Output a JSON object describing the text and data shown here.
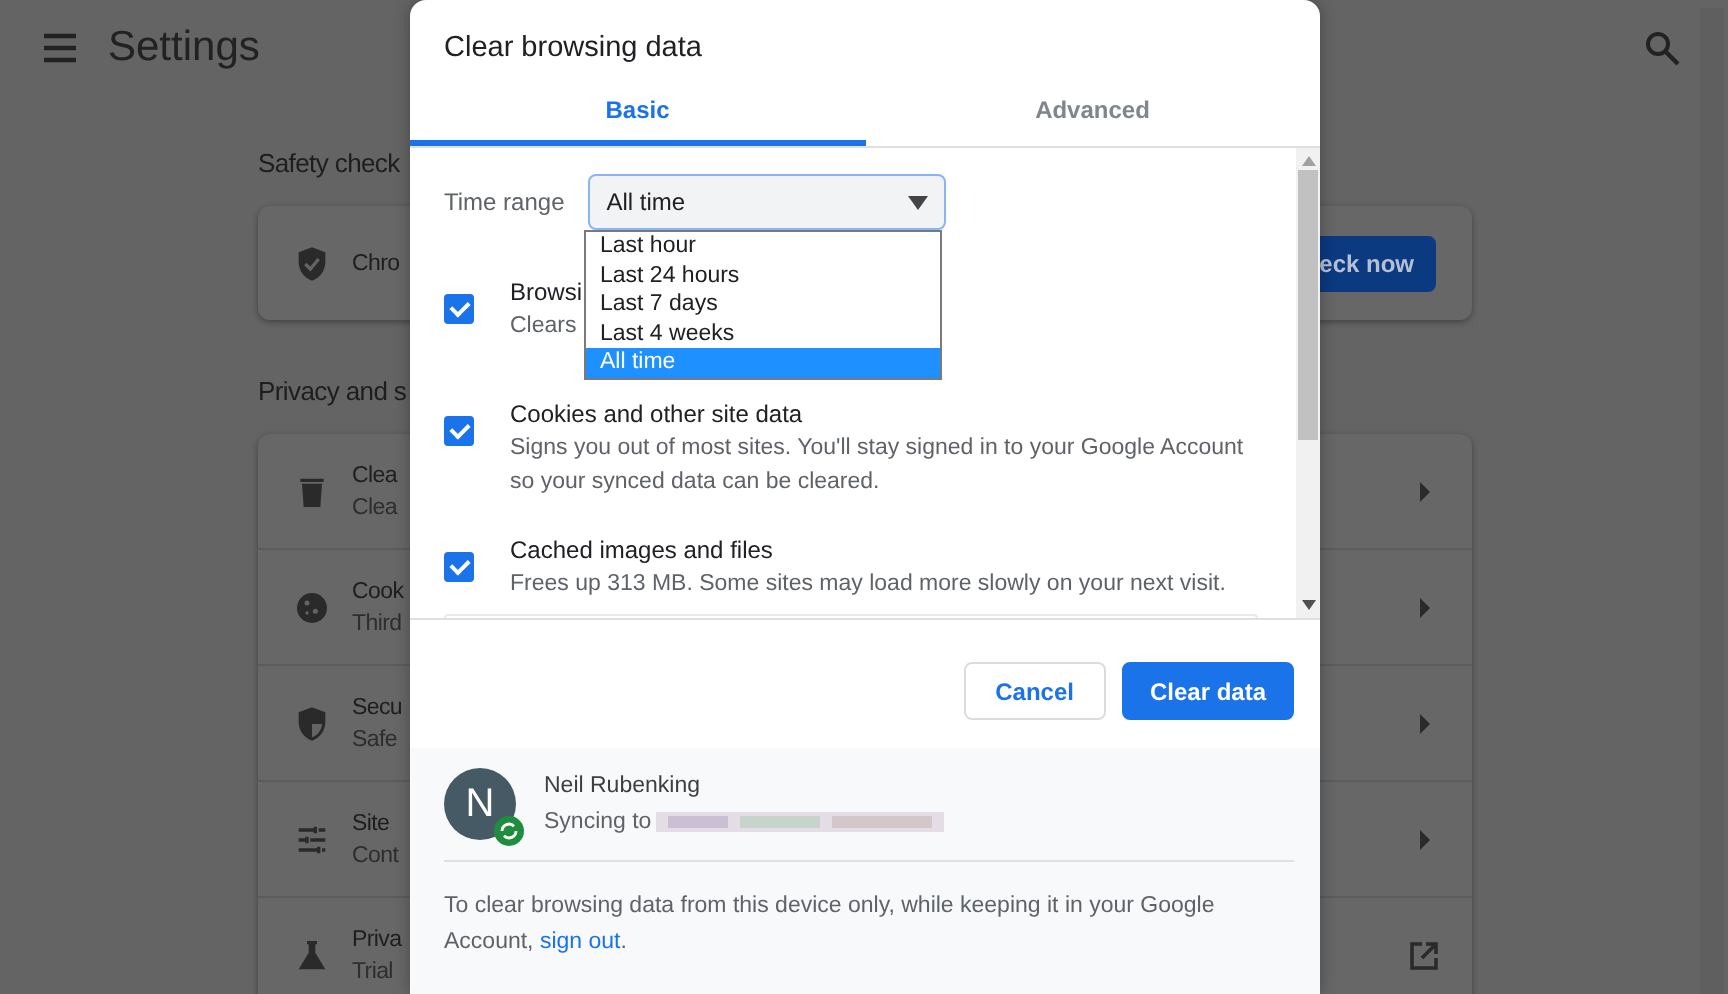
{
  "header": {
    "title": "Settings"
  },
  "sections": [
    {
      "title": "Safety check",
      "rows": [
        {
          "kind": "check",
          "title": "Chro",
          "button": "eck now"
        }
      ]
    },
    {
      "title": "Privacy and s",
      "rows": [
        {
          "kind": "subpage",
          "title": "Clea",
          "subtitle": "Clea"
        },
        {
          "kind": "subpage",
          "title": "Cook",
          "subtitle": "Third"
        },
        {
          "kind": "subpage",
          "title": "Secu",
          "subtitle": "Safe"
        },
        {
          "kind": "subpage",
          "title": "Site",
          "subtitle": "Cont"
        },
        {
          "kind": "external",
          "title": "Priva",
          "subtitle": "Trial"
        }
      ]
    }
  ],
  "dialog": {
    "title": "Clear browsing data",
    "tabs": [
      {
        "label": "Basic",
        "selected": true
      },
      {
        "label": "Advanced",
        "selected": false
      }
    ],
    "time_range": {
      "label": "Time range",
      "value": "All time",
      "expanded": true,
      "options": [
        {
          "label": "Last hour",
          "selected": false
        },
        {
          "label": "Last 24 hours",
          "selected": false
        },
        {
          "label": "Last 7 days",
          "selected": false
        },
        {
          "label": "Last 4 weeks",
          "selected": false
        },
        {
          "label": "All time",
          "selected": true
        }
      ]
    },
    "items": [
      {
        "title": "Browsi",
        "description": "Clears",
        "checked": true
      },
      {
        "title": "Cookies and other site data",
        "description": "Signs you out of most sites. You'll stay signed in to your Google Account so your synced data can be cleared.",
        "checked": true
      },
      {
        "title": "Cached images and files",
        "description": "Frees up 313 MB. Some sites may load more slowly on your next visit.",
        "checked": true
      }
    ],
    "buttons": [
      {
        "label": "Cancel",
        "kind": "secondary"
      },
      {
        "label": "Clear data",
        "kind": "primary"
      }
    ],
    "account": {
      "initial": "N",
      "name": "Neil Rubenking",
      "sync_label": "Syncing to"
    },
    "note": "To clear browsing data from this device only, while keeping it in your Google Account, ",
    "note_link": "sign out",
    "note_end": "."
  }
}
